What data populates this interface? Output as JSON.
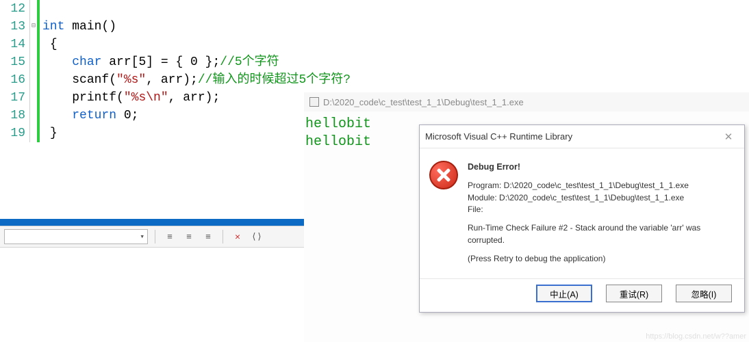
{
  "editor": {
    "lines": [
      {
        "n": "12"
      },
      {
        "n": "13"
      },
      {
        "n": "14"
      },
      {
        "n": "15"
      },
      {
        "n": "16"
      },
      {
        "n": "17"
      },
      {
        "n": "18"
      },
      {
        "n": "19"
      }
    ],
    "tokens": {
      "l13_kw": "int",
      "l13_fn": " main()",
      "l14_br": "{",
      "l15_indent": "    ",
      "l15_kw": "char",
      "l15_rest": " arr[5] = { 0 };",
      "l15_cmt": "//5个字符",
      "l16_indent": "    ",
      "l16_fn": "scanf(",
      "l16_str": "\"%s\"",
      "l16_rest": ", arr);",
      "l16_cmt": "//输入的时候超过5个字符?",
      "l17_indent": "    ",
      "l17_fn": "printf(",
      "l17_str": "\"%s\\n\"",
      "l17_rest": ", arr);",
      "l18_indent": "    ",
      "l18_kw": "return",
      "l18_rest": " 0;",
      "l19_br": "}"
    },
    "fold_glyph": "⊟"
  },
  "toolbar": {
    "dropdown_arrow": "▾",
    "btn1": "≡",
    "btn2": "≡",
    "btn3": "≡",
    "btn4": "✕",
    "btn5": "⟨⟩"
  },
  "console": {
    "title": "D:\\2020_code\\c_test\\test_1_1\\Debug\\test_1_1.exe",
    "line1": "hellobit",
    "line2": "hellobit"
  },
  "dialog": {
    "title": "Microsoft Visual C++ Runtime Library",
    "header": "Debug Error!",
    "program_line": "Program: D:\\2020_code\\c_test\\test_1_1\\Debug\\test_1_1.exe",
    "module_line": "Module: D:\\2020_code\\c_test\\test_1_1\\Debug\\test_1_1.exe",
    "file_line": "File:",
    "error_line": "Run-Time Check Failure #2 - Stack around the variable 'arr' was corrupted.",
    "retry_line": "(Press Retry to debug the application)",
    "abort_label": "中止(A)",
    "retry_label": "重试(R)",
    "ignore_label": "忽略(I)",
    "close_glyph": "✕"
  },
  "watermark": "https://blog.csdn.net/w??amer"
}
